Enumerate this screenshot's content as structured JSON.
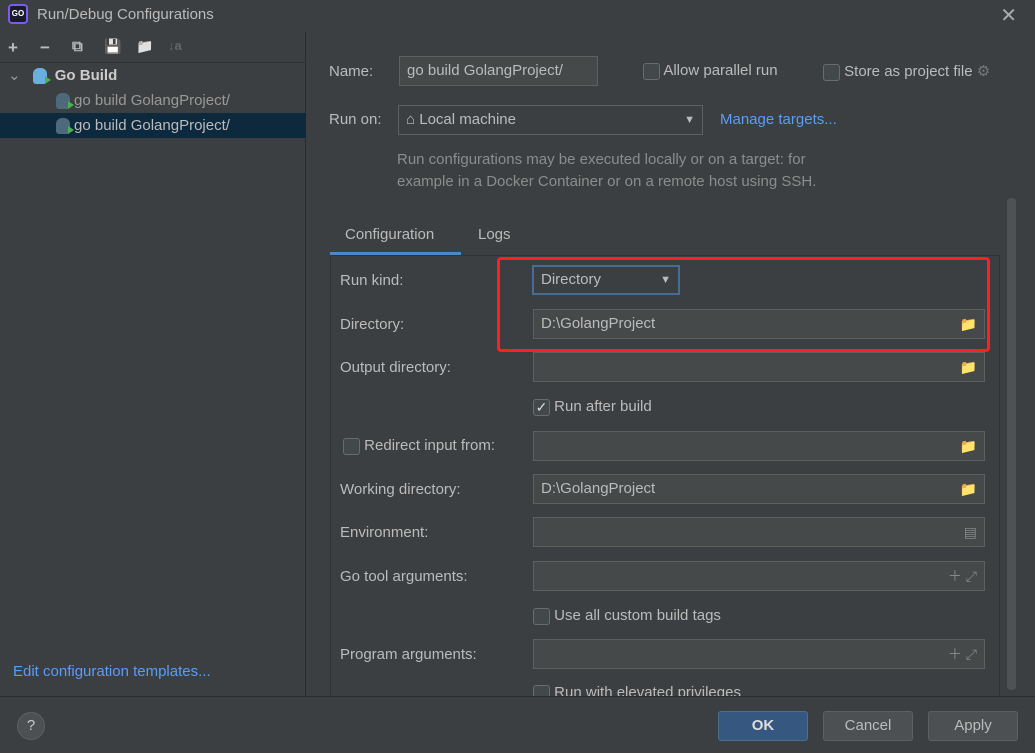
{
  "window": {
    "title": "Run/Debug Configurations",
    "logo_text": "GO"
  },
  "toolbar": {
    "add": "+",
    "remove": "−",
    "copy": "⧉",
    "save": "💾",
    "folder": "📁",
    "sort": "↓a"
  },
  "tree": {
    "group": "Go Build",
    "items": [
      {
        "label": "go build GolangProject/",
        "selected": false
      },
      {
        "label": "go build GolangProject/",
        "selected": true
      }
    ]
  },
  "left_footer": {
    "link": "Edit configuration templates..."
  },
  "header": {
    "name_label": "Name:",
    "name_value": "go build GolangProject/",
    "allow_parallel": "Allow parallel run",
    "store_project": "Store as project file",
    "run_on_label": "Run on:",
    "run_on_value": "Local machine",
    "manage_targets": "Manage targets...",
    "hint_line1": "Run configurations may be executed locally or on a target: for",
    "hint_line2": "example in a Docker Container or on a remote host using SSH."
  },
  "tabs": [
    {
      "label": "Configuration",
      "active": true
    },
    {
      "label": "Logs",
      "active": false
    }
  ],
  "form": {
    "run_kind_label": "Run kind:",
    "run_kind_value": "Directory",
    "directory_label": "Directory:",
    "directory_value": "D:\\GolangProject",
    "output_label": "Output directory:",
    "output_value": "",
    "run_after_build": "Run after build",
    "run_after_build_checked": true,
    "redirect_label": "Redirect input from:",
    "redirect_checked": false,
    "working_label": "Working directory:",
    "working_value": "D:\\GolangProject",
    "env_label": "Environment:",
    "gotool_label": "Go tool arguments:",
    "custom_tags": "Use all custom build tags",
    "custom_tags_checked": false,
    "program_label": "Program arguments:",
    "elevated": "Run with elevated privileges",
    "elevated_checked": false
  },
  "buttons": {
    "help": "?",
    "ok": "OK",
    "cancel": "Cancel",
    "apply": "Apply"
  },
  "colors": {
    "background": "#3c3f41",
    "accent": "#4a88c7",
    "link": "#589df6",
    "highlight": "#ff2020",
    "selected_row": "#0d293e"
  }
}
